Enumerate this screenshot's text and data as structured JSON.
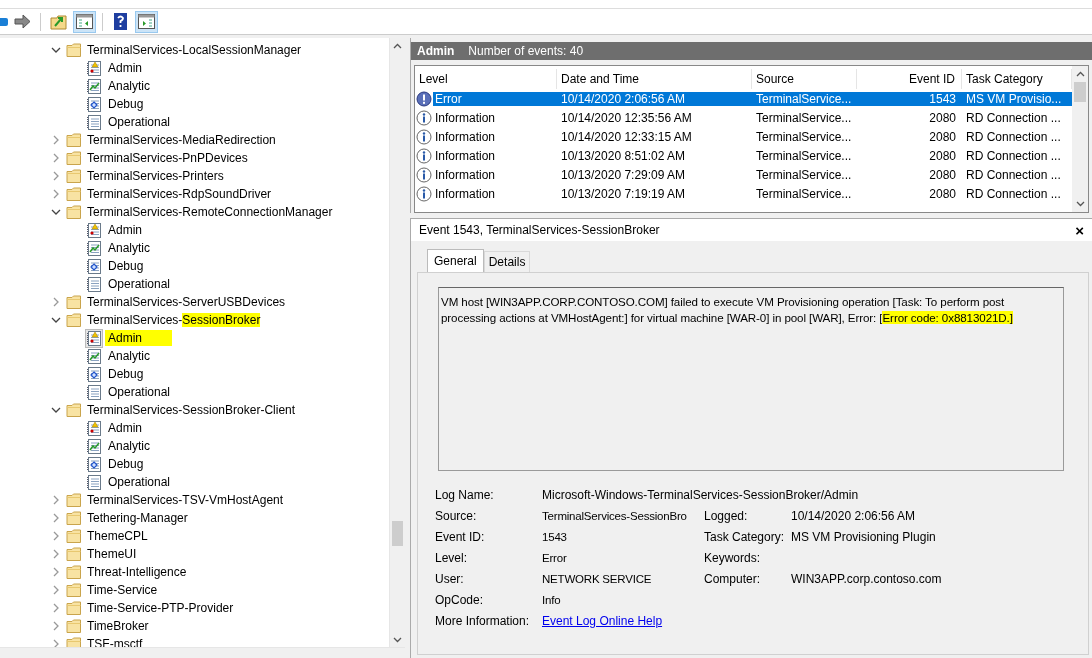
{
  "toolbar": {
    "buttons": [
      {
        "kind": "forward",
        "pressed": false
      },
      {
        "kind": "open",
        "pressed": false
      },
      {
        "kind": "tree",
        "pressed": true
      },
      {
        "kind": "help",
        "pressed": false
      },
      {
        "kind": "actions",
        "pressed": true
      }
    ]
  },
  "tree": {
    "items": [
      {
        "label": [
          {
            "text": "TerminalServices-LocalSessionManager",
            "highlighted": false
          }
        ],
        "expanded": true,
        "children": [
          {
            "kind": "admin",
            "label": "Admin",
            "selected": false,
            "highlighted": false
          },
          {
            "kind": "analytic",
            "label": "Analytic",
            "selected": false,
            "highlighted": false
          },
          {
            "kind": "debug",
            "label": "Debug",
            "selected": false,
            "highlighted": false
          },
          {
            "kind": "operational",
            "label": "Operational",
            "selected": false,
            "highlighted": false
          }
        ]
      },
      {
        "label": [
          {
            "text": "TerminalServices-MediaRedirection",
            "highlighted": false
          }
        ],
        "expanded": false
      },
      {
        "label": [
          {
            "text": "TerminalServices-PnPDevices",
            "highlighted": false
          }
        ],
        "expanded": false
      },
      {
        "label": [
          {
            "text": "TerminalServices-Printers",
            "highlighted": false
          }
        ],
        "expanded": false
      },
      {
        "label": [
          {
            "text": "TerminalServices-RdpSoundDriver",
            "highlighted": false
          }
        ],
        "expanded": false
      },
      {
        "label": [
          {
            "text": "TerminalServices-RemoteConnectionManager",
            "highlighted": false
          }
        ],
        "expanded": true,
        "children": [
          {
            "kind": "admin",
            "label": "Admin",
            "selected": false,
            "highlighted": false
          },
          {
            "kind": "analytic",
            "label": "Analytic",
            "selected": false,
            "highlighted": false
          },
          {
            "kind": "debug",
            "label": "Debug",
            "selected": false,
            "highlighted": false
          },
          {
            "kind": "operational",
            "label": "Operational",
            "selected": false,
            "highlighted": false
          }
        ]
      },
      {
        "label": [
          {
            "text": "TerminalServices-ServerUSBDevices",
            "highlighted": false
          }
        ],
        "expanded": false
      },
      {
        "label": [
          {
            "text": "TerminalServices-",
            "highlighted": false
          },
          {
            "text": "SessionBroker",
            "highlighted": true
          }
        ],
        "expanded": true,
        "children": [
          {
            "kind": "admin",
            "label": "Admin",
            "selected": true,
            "highlighted": true
          },
          {
            "kind": "analytic",
            "label": "Analytic",
            "selected": false,
            "highlighted": false
          },
          {
            "kind": "debug",
            "label": "Debug",
            "selected": false,
            "highlighted": false
          },
          {
            "kind": "operational",
            "label": "Operational",
            "selected": false,
            "highlighted": false
          }
        ]
      },
      {
        "label": [
          {
            "text": "TerminalServices-SessionBroker-Client",
            "highlighted": false
          }
        ],
        "expanded": true,
        "children": [
          {
            "kind": "admin",
            "label": "Admin",
            "selected": false,
            "highlighted": false
          },
          {
            "kind": "analytic",
            "label": "Analytic",
            "selected": false,
            "highlighted": false
          },
          {
            "kind": "debug",
            "label": "Debug",
            "selected": false,
            "highlighted": false
          },
          {
            "kind": "operational",
            "label": "Operational",
            "selected": false,
            "highlighted": false
          }
        ]
      },
      {
        "label": [
          {
            "text": "TerminalServices-TSV-VmHostAgent",
            "highlighted": false
          }
        ],
        "expanded": false
      },
      {
        "label": [
          {
            "text": "Tethering-Manager",
            "highlighted": false
          }
        ],
        "expanded": false
      },
      {
        "label": [
          {
            "text": "ThemeCPL",
            "highlighted": false
          }
        ],
        "expanded": false
      },
      {
        "label": [
          {
            "text": "ThemeUI",
            "highlighted": false
          }
        ],
        "expanded": false
      },
      {
        "label": [
          {
            "text": "Threat-Intelligence",
            "highlighted": false
          }
        ],
        "expanded": false
      },
      {
        "label": [
          {
            "text": "Time-Service",
            "highlighted": false
          }
        ],
        "expanded": false
      },
      {
        "label": [
          {
            "text": "Time-Service-PTP-Provider",
            "highlighted": false
          }
        ],
        "expanded": false
      },
      {
        "label": [
          {
            "text": "TimeBroker",
            "highlighted": false
          }
        ],
        "expanded": false
      },
      {
        "label": [
          {
            "text": "TSF-msctf",
            "highlighted": false
          }
        ],
        "expanded": false
      }
    ]
  },
  "log_header": {
    "title": "Admin",
    "count": "Number of events: 40"
  },
  "table": {
    "columns": [
      "Level",
      "Date and Time",
      "Source",
      "Event ID",
      "Task Category"
    ],
    "rows": [
      {
        "kind": "error",
        "selected": true,
        "cells": [
          "Error",
          "10/14/2020 2:06:56 AM",
          "TerminalService...",
          "1543",
          "MS VM Provisio..."
        ]
      },
      {
        "kind": "information",
        "selected": false,
        "cells": [
          "Information",
          "10/14/2020 12:35:56 AM",
          "TerminalService...",
          "2080",
          "RD Connection ..."
        ]
      },
      {
        "kind": "information",
        "selected": false,
        "cells": [
          "Information",
          "10/14/2020 12:33:15 AM",
          "TerminalService...",
          "2080",
          "RD Connection ..."
        ]
      },
      {
        "kind": "information",
        "selected": false,
        "cells": [
          "Information",
          "10/13/2020 8:51:02 AM",
          "TerminalService...",
          "2080",
          "RD Connection ..."
        ]
      },
      {
        "kind": "information",
        "selected": false,
        "cells": [
          "Information",
          "10/13/2020 7:29:09 AM",
          "TerminalService...",
          "2080",
          "RD Connection ..."
        ]
      },
      {
        "kind": "information",
        "selected": false,
        "cells": [
          "Information",
          "10/13/2020 7:19:19 AM",
          "TerminalService...",
          "2080",
          "RD Connection ..."
        ]
      }
    ]
  },
  "details": {
    "title": "Event 1543, TerminalServices-SessionBroker",
    "close": "×",
    "tabs": [
      {
        "label": "General",
        "selected": true
      },
      {
        "label": "Details",
        "selected": false
      }
    ],
    "message": [
      {
        "text": "VM host [WIN3APP.CORP.CONTOSO.COM] failed to execute VM Provisioning operation [Task: To perform post processing actions at VMHostAgent:] for virtual machine [WAR-0] in pool [WAR], Error: [",
        "highlighted": false
      },
      {
        "text": "Error code: 0x8813021D.]",
        "highlighted": true
      }
    ],
    "fields": [
      [
        {
          "label": "Log Name:",
          "value": "Microsoft-Windows-TerminalServices-SessionBroker/Admin"
        }
      ],
      [
        {
          "label": "Source:",
          "value": "TerminalServices-SessionBro"
        },
        {
          "label": "Logged:",
          "value": "10/14/2020 2:06:56 AM"
        }
      ],
      [
        {
          "label": "Event ID:",
          "value": "1543"
        },
        {
          "label": "Task Category:",
          "value": "MS VM Provisioning Plugin"
        }
      ],
      [
        {
          "label": "Level:",
          "value": "Error"
        },
        {
          "label": "Keywords:"
        }
      ],
      [
        {
          "label": "User:",
          "value": "NETWORK SERVICE"
        },
        {
          "label": "Computer:",
          "value": "WIN3APP.corp.contoso.com"
        }
      ],
      [
        {
          "label": "OpCode:",
          "value": "Info"
        }
      ],
      [
        {
          "label": "More Information:",
          "link": "Event Log Online Help"
        }
      ]
    ]
  }
}
